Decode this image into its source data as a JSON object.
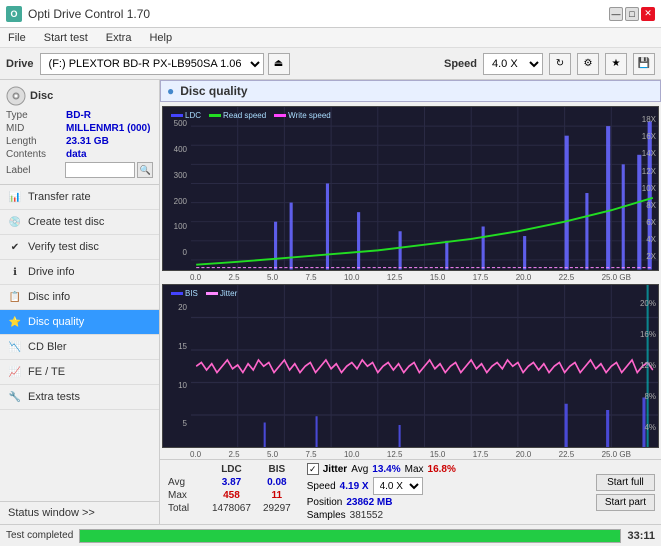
{
  "titlebar": {
    "title": "Opti Drive Control 1.70",
    "minimize": "—",
    "maximize": "□",
    "close": "✕"
  },
  "menubar": {
    "items": [
      "File",
      "Start test",
      "Extra",
      "Help"
    ]
  },
  "toolbar": {
    "drive_label": "Drive",
    "drive_value": "(F:) PLEXTOR BD-R  PX-LB950SA 1.06",
    "speed_label": "Speed",
    "speed_value": "4.0 X"
  },
  "disc": {
    "header": "Disc",
    "type_label": "Type",
    "type_value": "BD-R",
    "mid_label": "MID",
    "mid_value": "MILLENMR1 (000)",
    "length_label": "Length",
    "length_value": "23.31 GB",
    "contents_label": "Contents",
    "contents_value": "data",
    "label_label": "Label"
  },
  "nav": {
    "items": [
      {
        "label": "Transfer rate",
        "icon": "📊",
        "active": false
      },
      {
        "label": "Create test disc",
        "icon": "💿",
        "active": false
      },
      {
        "label": "Verify test disc",
        "icon": "✔",
        "active": false
      },
      {
        "label": "Drive info",
        "icon": "ℹ",
        "active": false
      },
      {
        "label": "Disc info",
        "icon": "📋",
        "active": false
      },
      {
        "label": "Disc quality",
        "icon": "⭐",
        "active": true
      },
      {
        "label": "CD Bler",
        "icon": "📉",
        "active": false
      },
      {
        "label": "FE / TE",
        "icon": "📈",
        "active": false
      },
      {
        "label": "Extra tests",
        "icon": "🔧",
        "active": false
      }
    ],
    "status_window": "Status window >> "
  },
  "chart": {
    "title": "Disc quality",
    "legend_upper": [
      "LDC",
      "Read speed",
      "Write speed"
    ],
    "legend_lower": [
      "BIS",
      "Jitter"
    ],
    "x_labels": [
      "0.0",
      "2.5",
      "5.0",
      "7.5",
      "10.0",
      "12.5",
      "15.0",
      "17.5",
      "20.0",
      "22.5",
      "25.0"
    ],
    "y_upper_labels": [
      "18X",
      "16X",
      "14X",
      "12X",
      "10X",
      "8X",
      "6X",
      "4X",
      "2X"
    ],
    "y_lower_labels": [
      "20%",
      "16%",
      "12%",
      "8%",
      "4%"
    ],
    "gb_label": "GB"
  },
  "stats": {
    "headers": [
      "LDC",
      "BIS"
    ],
    "avg_label": "Avg",
    "avg_ldc": "3.87",
    "avg_bis": "0.08",
    "max_label": "Max",
    "max_ldc": "458",
    "max_bis": "11",
    "total_label": "Total",
    "total_ldc": "1478067",
    "total_bis": "29297",
    "jitter_label": "Jitter",
    "jitter_avg": "13.4%",
    "jitter_max": "16.8%",
    "speed_label": "Speed",
    "speed_value": "4.19 X",
    "speed_select": "4.0 X",
    "position_label": "Position",
    "position_value": "23862 MB",
    "samples_label": "Samples",
    "samples_value": "381552",
    "start_full": "Start full",
    "start_part": "Start part"
  },
  "bottom": {
    "status": "Test completed",
    "progress": 100,
    "time": "33:11"
  }
}
